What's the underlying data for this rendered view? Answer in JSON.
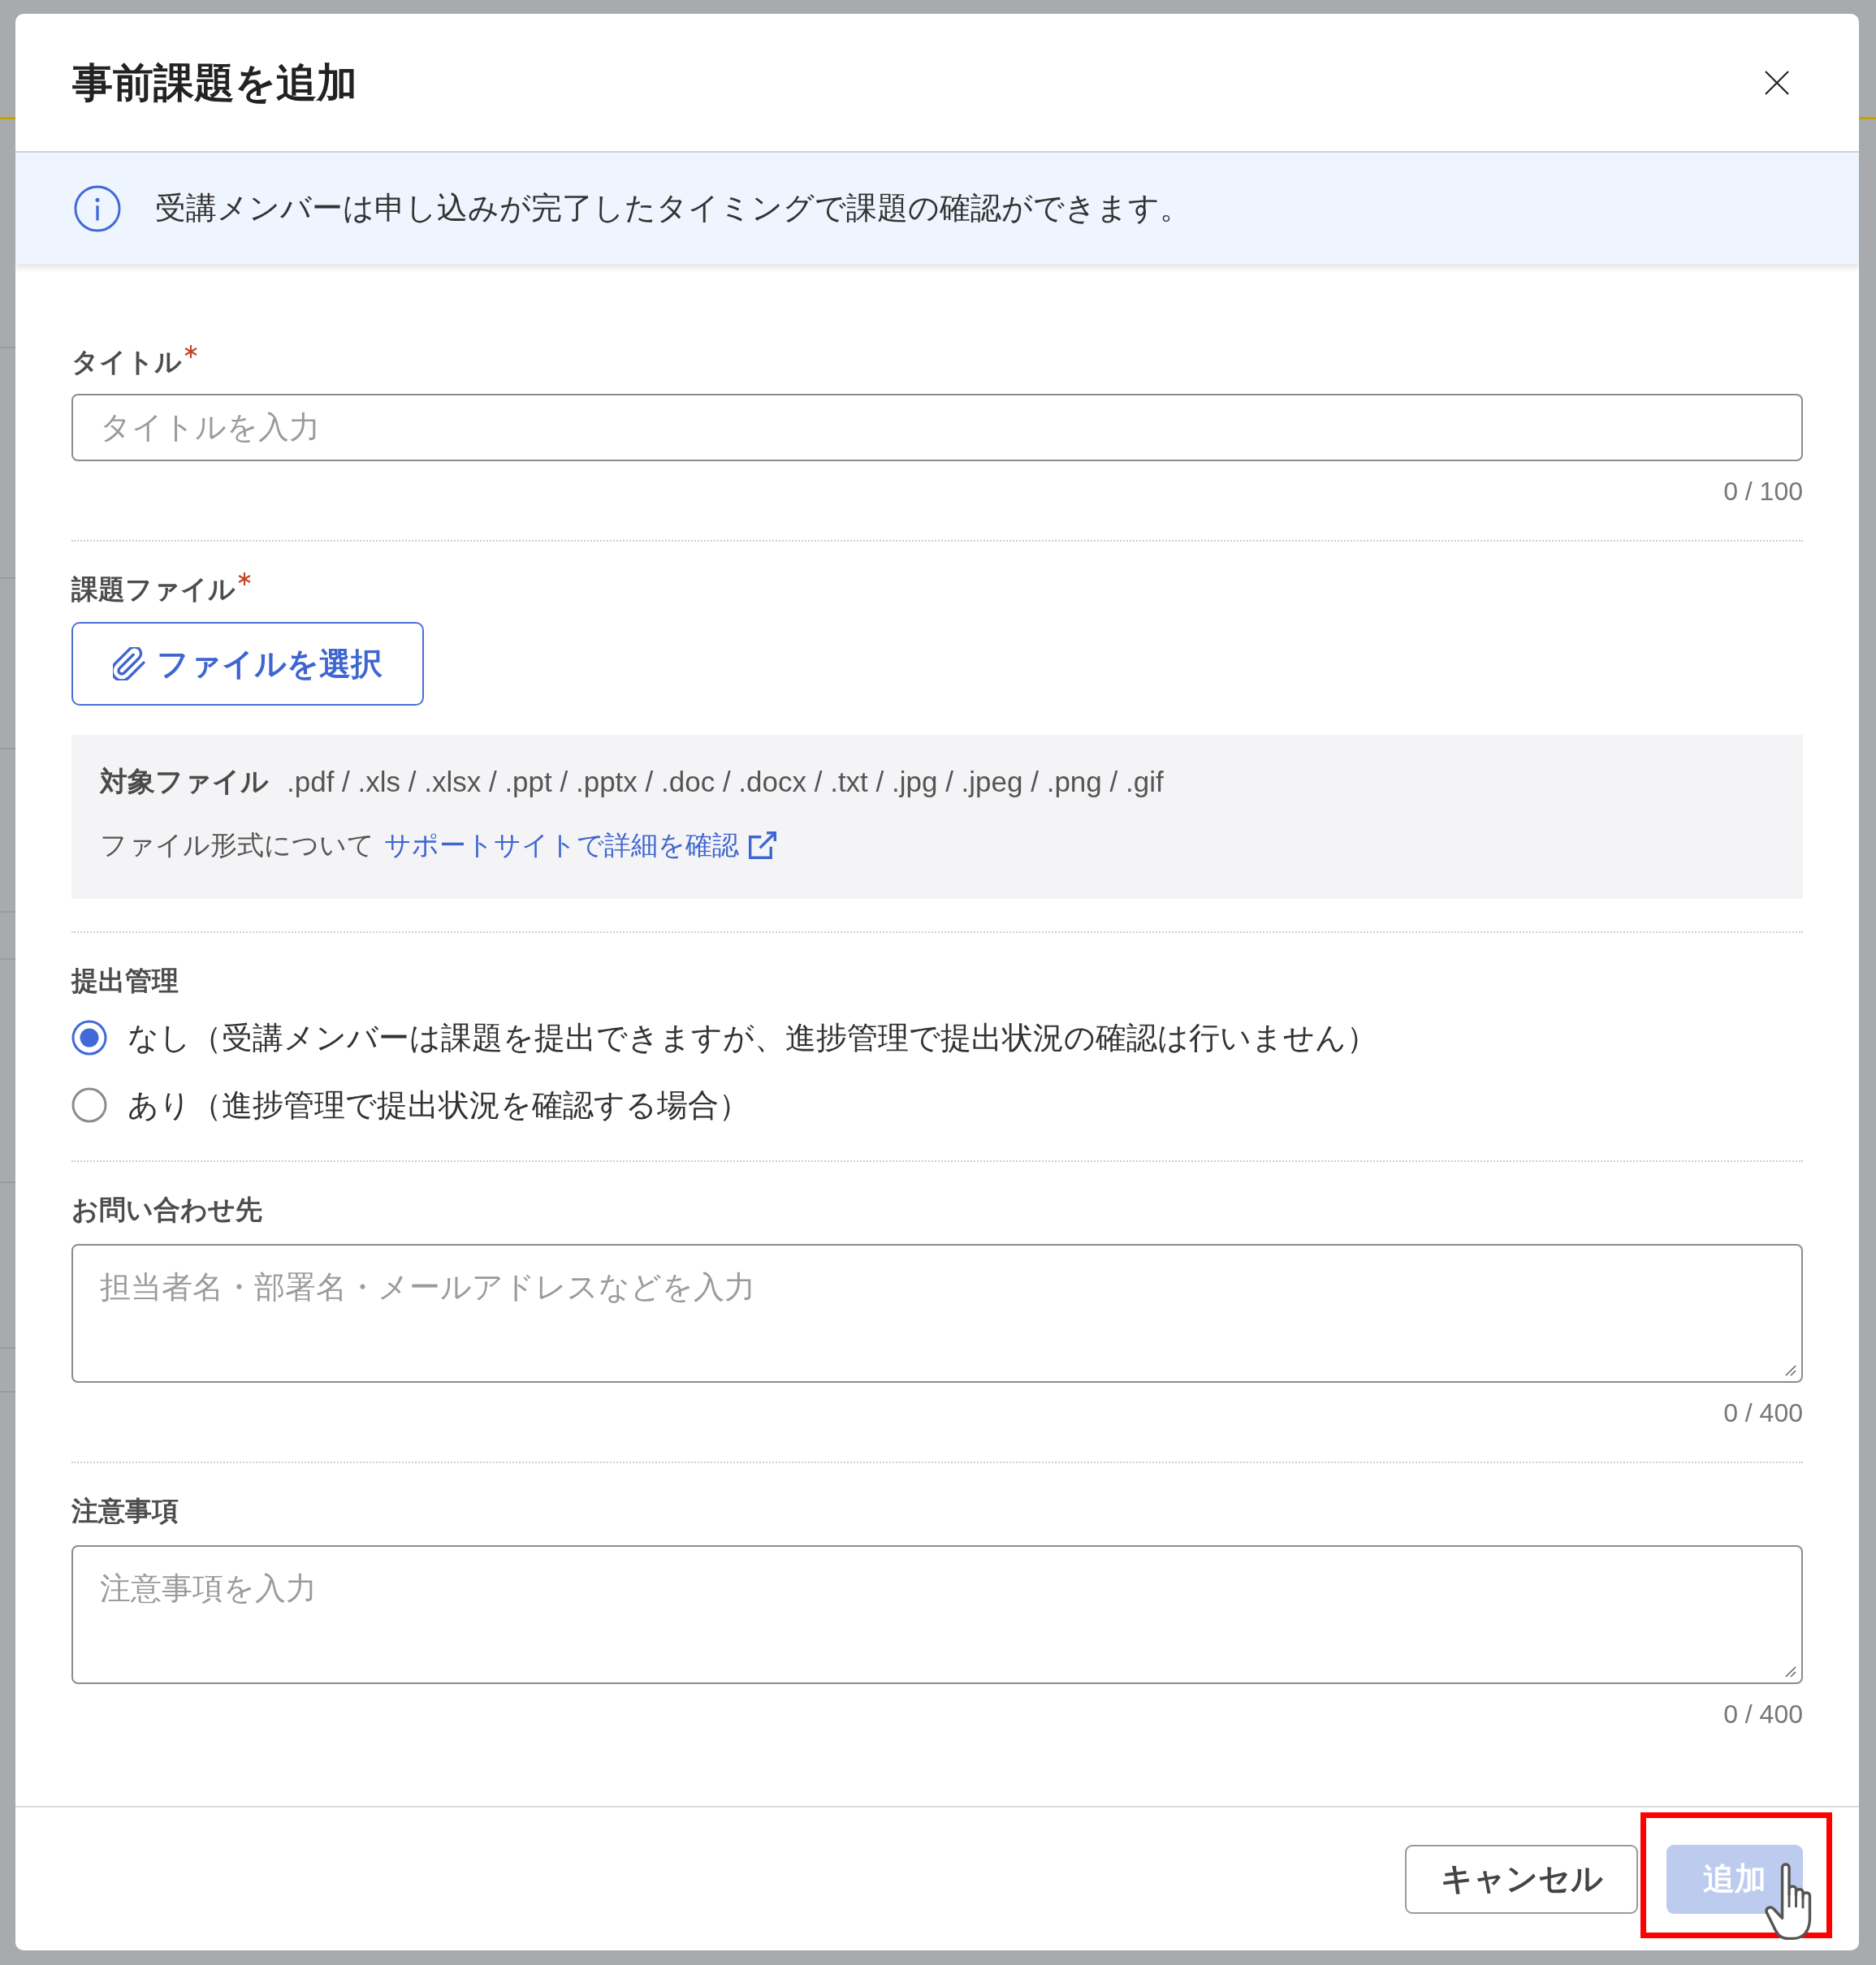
{
  "dialog": {
    "title": "事前課題を追加"
  },
  "notice": {
    "text": "受講メンバーは申し込みが完了したタイミングで課題の確認ができます。"
  },
  "fields": [
    {
      "kind": "text",
      "label": "タイトル",
      "required": true,
      "placeholder": "タイトルを入力",
      "counter": "0 / 100"
    },
    {
      "kind": "file",
      "label": "課題ファイル",
      "required": true,
      "button": "ファイルを選択",
      "file_types_label": "対象ファイル",
      "file_types": ".pdf / .xls / .xlsx / .ppt / .pptx / .doc / .docx / .txt / .jpg / .jpeg / .png / .gif",
      "format_note": "ファイル形式について",
      "support_link": "サポートサイトで詳細を確認"
    },
    {
      "kind": "radio",
      "label": "提出管理",
      "required": false,
      "options": [
        {
          "label": "なし（受講メンバーは課題を提出できますが、進捗管理で提出状況の確認は行いません）",
          "selected": true
        },
        {
          "label": "あり（進捗管理で提出状況を確認する場合）",
          "selected": false
        }
      ]
    },
    {
      "kind": "textarea",
      "label": "お問い合わせ先",
      "required": false,
      "placeholder": "担当者名・部署名・メールアドレスなどを入力",
      "counter": "0 / 400"
    },
    {
      "kind": "textarea",
      "label": "注意事項",
      "required": false,
      "placeholder": "注意事項を入力",
      "counter": "0 / 400"
    }
  ],
  "footer": {
    "buttons": [
      {
        "kind": "secondary",
        "label": "キャンセル",
        "disabled": false,
        "highlighted": false
      },
      {
        "kind": "primary",
        "label": "追加",
        "disabled": true,
        "highlighted": true
      }
    ]
  }
}
